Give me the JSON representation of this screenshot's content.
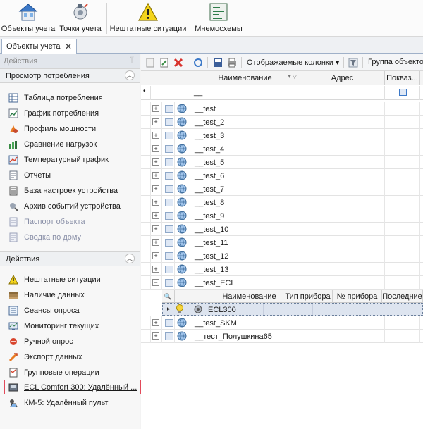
{
  "ribbon": {
    "buttons": [
      {
        "label": "Объекты учета",
        "icon": "house-icon"
      },
      {
        "label": "Точки учета",
        "icon": "meter-point-icon"
      },
      {
        "label": "Нештатные ситуации",
        "icon": "warning-icon"
      },
      {
        "label": "Мнемосхемы",
        "icon": "diagram-icon"
      }
    ]
  },
  "tabs": [
    {
      "label": "Объекты учета",
      "close": "✕"
    }
  ],
  "left_panel": {
    "header": "Действия",
    "pin": "ᛘ",
    "group1": {
      "title": "Просмотр потребления",
      "chevron": "︿",
      "items": [
        {
          "label": "Таблица потребления",
          "icon": "table-icon"
        },
        {
          "label": "График потребления",
          "icon": "chart-icon"
        },
        {
          "label": "Профиль мощности",
          "icon": "power-profile-icon"
        },
        {
          "label": "Сравнение нагрузок",
          "icon": "compare-icon"
        },
        {
          "label": "Температурный график",
          "icon": "temperature-chart-icon"
        },
        {
          "label": "Отчеты",
          "icon": "report-icon"
        },
        {
          "label": "База настроек устройства",
          "icon": "settings-db-icon"
        },
        {
          "label": "Архив событий устройства",
          "icon": "event-archive-icon"
        },
        {
          "label": "Паспорт объекта",
          "icon": "passport-icon"
        },
        {
          "label": "Сводка по дому",
          "icon": "summary-icon"
        }
      ]
    },
    "group2": {
      "title": "Действия",
      "chevron": "︿",
      "items": [
        {
          "label": "Нештатные ситуации",
          "icon": "warning-icon"
        },
        {
          "label": "Наличие данных",
          "icon": "data-availability-icon"
        },
        {
          "label": "Сеансы опроса",
          "icon": "poll-session-icon"
        },
        {
          "label": "Мониторинг текущих",
          "icon": "monitoring-icon"
        },
        {
          "label": "Ручной опрос",
          "icon": "manual-poll-icon"
        },
        {
          "label": "Экспорт данных",
          "icon": "export-icon"
        },
        {
          "label": "Групповые операции",
          "icon": "group-operations-icon"
        },
        {
          "label": "ECL Comfort 300: Удалённый ...",
          "icon": "remote-panel-icon"
        },
        {
          "label": "КМ-5: Удалённый пульт",
          "icon": "remote-panel-icon"
        }
      ]
    }
  },
  "toolbar": {
    "columns_label": "Отображаемые колонки",
    "group_label": "Группа объекто"
  },
  "grid": {
    "columns": [
      "Наименование",
      "Адрес",
      "Покваз..."
    ],
    "filter_value": "__",
    "rows": [
      {
        "name": "__test",
        "expander": "+"
      },
      {
        "name": "__test_2",
        "expander": "+"
      },
      {
        "name": "__test_3",
        "expander": "+"
      },
      {
        "name": "__test_4",
        "expander": "+"
      },
      {
        "name": "__test_5",
        "expander": "+"
      },
      {
        "name": "__test_6",
        "expander": "+"
      },
      {
        "name": "__test_7",
        "expander": "+"
      },
      {
        "name": "__test_8",
        "expander": "+"
      },
      {
        "name": "__test_9",
        "expander": "+"
      },
      {
        "name": "__test_10",
        "expander": "+"
      },
      {
        "name": "__test_11",
        "expander": "+"
      },
      {
        "name": "__test_12",
        "expander": "+"
      },
      {
        "name": "__test_13",
        "expander": "+"
      },
      {
        "name": "__test_ECL",
        "expander": "−"
      }
    ],
    "detail": {
      "columns": [
        "Наименование",
        "Тип прибора",
        "№ прибора",
        "Последние"
      ],
      "row": {
        "name": "ECL300"
      }
    },
    "rows_after": [
      {
        "name": "__test_SKM",
        "expander": "+"
      },
      {
        "name": "__тест_Полушкина65",
        "expander": "+"
      }
    ]
  },
  "colors": {
    "selection_frame": "#e24a5a",
    "detail_selected": "#dde4ef"
  }
}
